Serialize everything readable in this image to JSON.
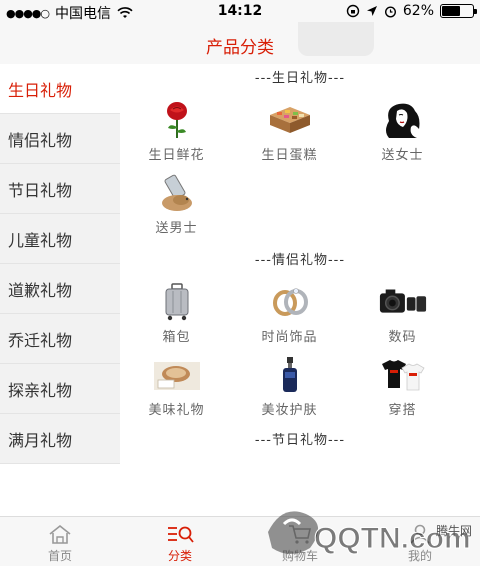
{
  "status_bar": {
    "carrier": "中国电信",
    "time": "14:12",
    "battery_percent": "62%",
    "battery_level": 0.62
  },
  "nav": {
    "title": "产品分类"
  },
  "sidebar": {
    "items": [
      {
        "label": "生日礼物"
      },
      {
        "label": "情侣礼物"
      },
      {
        "label": "节日礼物"
      },
      {
        "label": "儿童礼物"
      },
      {
        "label": "道歉礼物"
      },
      {
        "label": "乔迁礼物"
      },
      {
        "label": "探亲礼物"
      },
      {
        "label": "满月礼物"
      }
    ]
  },
  "sections": [
    {
      "title": "---生日礼物---",
      "items": [
        {
          "label": "生日鲜花",
          "icon": "rose-icon"
        },
        {
          "label": "生日蛋糕",
          "icon": "cake-icon"
        },
        {
          "label": "送女士",
          "icon": "woman-icon"
        },
        {
          "label": "送男士",
          "icon": "phone-stand-icon"
        }
      ]
    },
    {
      "title": "---情侣礼物---",
      "items": [
        {
          "label": "箱包",
          "icon": "suitcase-icon"
        },
        {
          "label": "时尚饰品",
          "icon": "rings-icon"
        },
        {
          "label": "数码",
          "icon": "camera-icon"
        },
        {
          "label": "美味礼物",
          "icon": "food-icon"
        },
        {
          "label": "美妆护肤",
          "icon": "cosmetic-bottle-icon"
        },
        {
          "label": "穿搭",
          "icon": "tshirt-icon"
        }
      ]
    },
    {
      "title": "---节日礼物---",
      "items": []
    }
  ],
  "tab_bar": {
    "tabs": [
      {
        "label": "首页",
        "icon": "home-icon"
      },
      {
        "label": "分类",
        "icon": "category-search-icon"
      },
      {
        "label": "购物车",
        "icon": "cart-icon"
      },
      {
        "label": "我的",
        "icon": "user-icon"
      }
    ],
    "visible_labels": [
      "首页",
      "分类",
      "购物车"
    ]
  },
  "watermark": {
    "text": "QQTN.com",
    "small": "腾牛网"
  },
  "colors": {
    "accent": "#d81e06",
    "sidebar_bg": "#f2f2f2",
    "bar_bg": "#f7f7f7"
  }
}
